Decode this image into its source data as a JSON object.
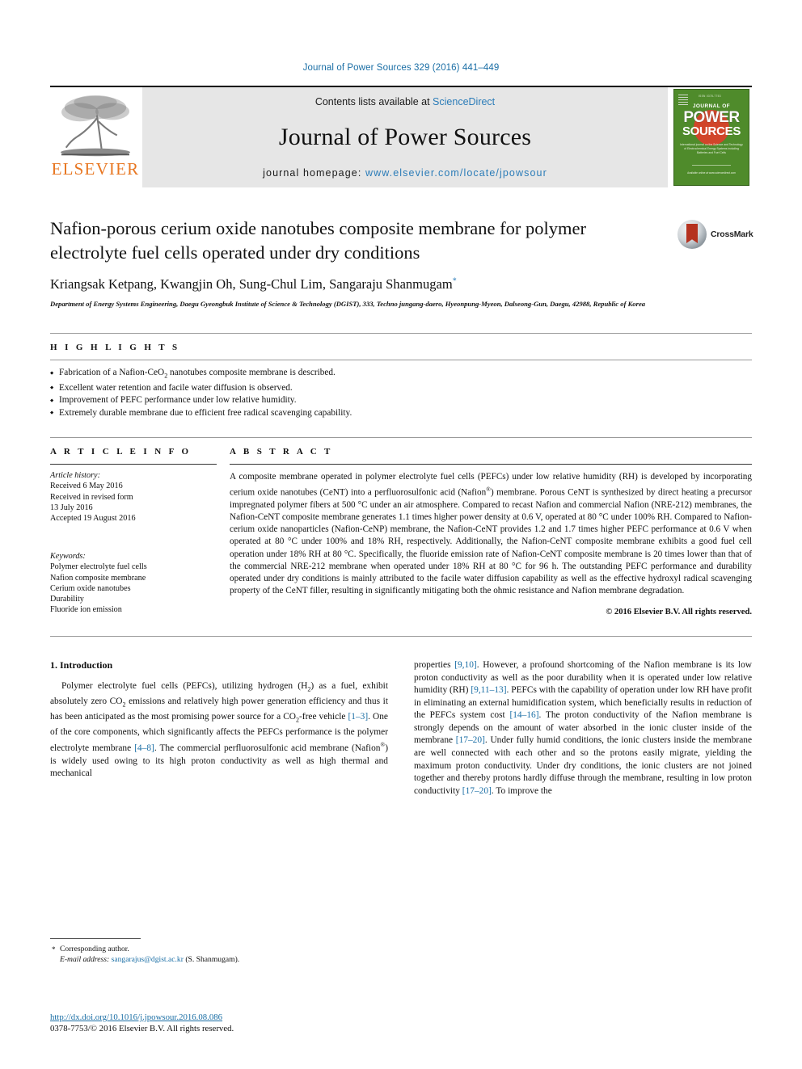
{
  "running_head": "Journal of Power Sources 329 (2016) 441–449",
  "masthead": {
    "publisher_name": "ELSEVIER",
    "contents_prefix": "Contents lists available at ",
    "contents_link": "ScienceDirect",
    "journal_title": "Journal of Power Sources",
    "homepage_prefix": "journal homepage: ",
    "homepage_url": "www.elsevier.com/locate/jpowsour",
    "cover": {
      "top_tiny": "ISSN 0378-7753",
      "line1": "JOURNAL OF",
      "line2": "POWER",
      "line3": "SOURCES",
      "blurb": "International journal on the Science and Technology of Electrochemical Energy Systems including Batteries and Fuel Cells",
      "footline": "Available online at\nwww.sciencedirect.com"
    }
  },
  "article": {
    "title": "Nafion-porous cerium oxide nanotubes composite membrane for polymer electrolyte fuel cells operated under dry conditions",
    "authors": "Kriangsak Ketpang, Kwangjin Oh, Sung-Chul Lim, Sangaraju Shanmugam",
    "corresponding_marker": "*",
    "affiliation": "Department of Energy Systems Engineering, Daegu Gyeongbuk Institute of Science & Technology (DGIST), 333, Techno jungang-daero, Hyeonpung-Myeon, Dalseong-Gun, Daegu, 42988, Republic of Korea",
    "crossmark_label": "CrossMark"
  },
  "highlights": {
    "heading": "H I G H L I G H T S",
    "items": [
      "Fabrication of a Nafion-CeO2 nanotubes composite membrane is described.",
      "Excellent water retention and facile water diffusion is observed.",
      "Improvement of PEFC performance under low relative humidity.",
      "Extremely durable membrane due to efficient free radical scavenging capability."
    ]
  },
  "article_info": {
    "heading": "A R T I C L E   I N F O",
    "history_label": "Article history:",
    "history_lines": [
      "Received 6 May 2016",
      "Received in revised form",
      "13 July 2016",
      "Accepted 19 August 2016"
    ],
    "keywords_label": "Keywords:",
    "keywords": [
      "Polymer electrolyte fuel cells",
      "Nafion composite membrane",
      "Cerium oxide nanotubes",
      "Durability",
      "Fluoride ion emission"
    ]
  },
  "abstract": {
    "heading": "A B S T R A C T",
    "text": "A composite membrane operated in polymer electrolyte fuel cells (PEFCs) under low relative humidity (RH) is developed by incorporating cerium oxide nanotubes (CeNT) into a perfluorosulfonic acid (Nafion®) membrane. Porous CeNT is synthesized by direct heating a precursor impregnated polymer fibers at 500 °C under an air atmosphere. Compared to recast Nafion and commercial Nafion (NRE-212) membranes, the Nafion-CeNT composite membrane generates 1.1 times higher power density at 0.6 V, operated at 80 °C under 100% RH. Compared to Nafion-cerium oxide nanoparticles (Nafion-CeNP) membrane, the Nafion-CeNT provides 1.2 and 1.7 times higher PEFC performance at 0.6 V when operated at 80 °C under 100% and 18% RH, respectively. Additionally, the Nafion-CeNT composite membrane exhibits a good fuel cell operation under 18% RH at 80 °C. Specifically, the fluoride emission rate of Nafion-CeNT composite membrane is 20 times lower than that of the commercial NRE-212 membrane when operated under 18% RH at 80 °C for 96 h. The outstanding PEFC performance and durability operated under dry conditions is mainly attributed to the facile water diffusion capability as well as the effective hydroxyl radical scavenging property of the CeNT filler, resulting in significantly mitigating both the ohmic resistance and Nafion membrane degradation.",
    "copyright": "© 2016 Elsevier B.V. All rights reserved."
  },
  "introduction": {
    "section_number": "1.",
    "section_title": "Introduction",
    "left_paragraph_html": "Polymer electrolyte fuel cells (PEFCs), utilizing hydrogen (H<sub>2</sub>) as a fuel, exhibit absolutely zero CO<sub>2</sub> emissions and relatively high power generation efficiency and thus it has been anticipated as the most promising power source for a CO<sub>2</sub>-free vehicle <span class=\"ref\">[1–3]</span>. One of the core components, which significantly affects the PEFCs performance is the polymer electrolyte membrane <span class=\"ref\">[4–8]</span>. The commercial perfluorosulfonic acid membrane (Nafion<sup>®</sup>) is widely used owing to its high proton conductivity as well as high thermal and mechanical",
    "right_paragraph_html": "properties <span class=\"ref\">[9,10]</span>. However, a profound shortcoming of the Nafion membrane is its low proton conductivity as well as the poor durability when it is operated under low relative humidity (RH) <span class=\"ref\">[9,11–13]</span>. PEFCs with the capability of operation under low RH have profit in eliminating an external humidification system, which beneficially results in reduction of the PEFCs system cost <span class=\"ref\">[14–16]</span>. The proton conductivity of the Nafion membrane is strongly depends on the amount of water absorbed in the ionic cluster inside of the membrane <span class=\"ref\">[17–20]</span>. Under fully humid conditions, the ionic clusters inside the membrane are well connected with each other and so the protons easily migrate, yielding the maximum proton conductivity. Under dry conditions, the ionic clusters are not joined together and thereby protons hardly diffuse through the membrane, resulting in low proton conductivity <span class=\"ref\">[17–20]</span>. To improve the"
  },
  "footnote": {
    "corresponding_author": "Corresponding author.",
    "email_label": "E-mail address:",
    "email": "sangarajus@dgist.ac.kr",
    "email_suffix": "(S. Shanmugam)."
  },
  "footer": {
    "doi": "http://dx.doi.org/10.1016/j.jpowsour.2016.08.086",
    "issn_line": "0378-7753/© 2016 Elsevier B.V. All rights reserved."
  },
  "colors": {
    "link_blue": "#1a6ea5",
    "elsevier_orange": "#e87722",
    "cover_green": "#4f8b2b",
    "cover_orb_red": "#d1452a"
  }
}
